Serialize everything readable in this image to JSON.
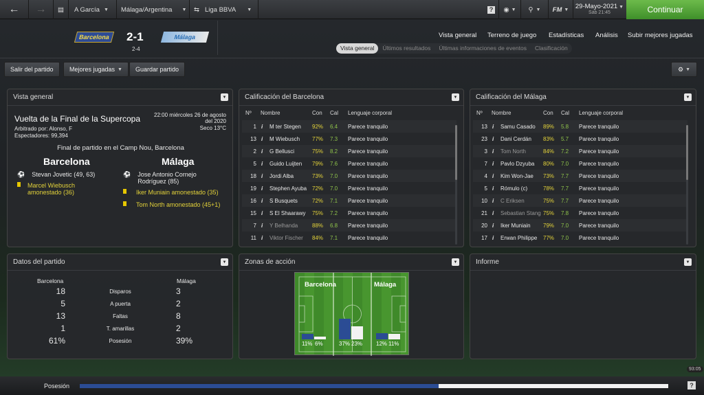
{
  "topbar": {
    "team": "A García",
    "nation": "Málaga/Argentina",
    "competition": "Liga BBVA",
    "date": "29-Mayo-2021",
    "subdate": "Sáb 21:45",
    "continue": "Continuar",
    "fm": "FM",
    "help": "?"
  },
  "match": {
    "home": "Barcelona",
    "away": "Málaga",
    "score": "2-1",
    "aggregate": "2-4"
  },
  "menu": [
    "Vista general",
    "Terreno de juego",
    "Estadísticas",
    "Análisis",
    "Subir mejores jugadas"
  ],
  "subtabs": [
    "Vista general",
    "Últimos resultados",
    "Últimas informaciones de eventos",
    "Clasificación"
  ],
  "actions": {
    "leave": "Salir del partido",
    "highlights": "Mejores jugadas",
    "save": "Guardar partido"
  },
  "overview": {
    "title": "Vista general",
    "competition": "Vuelta de la Final de la Supercopa",
    "datetime": "22:00 miércoles 26 de agosto del 2020",
    "referee": "Arbitrado por: Alonso, F",
    "spectators": "Espectadores: 99,394",
    "weather": "Seco 13°C",
    "final": "Final de partido en el Camp Nou, Barcelona",
    "home_events": [
      {
        "text": "Stevan Jovetic (49, 63)",
        "type": "goal"
      },
      {
        "text": "Marcel Wiebusch amonestado (36)",
        "type": "card"
      }
    ],
    "away_events": [
      {
        "text": "Jose Antonio Cornejo Rodríguez (85)",
        "type": "goal"
      },
      {
        "text": "Iker Muniain amonestado (35)",
        "type": "card"
      },
      {
        "text": "Tom North amonestado (45+1)",
        "type": "card"
      }
    ]
  },
  "ratings_home": {
    "title": "Calificación del Barcelona",
    "headers": [
      "Nº",
      "Nombre",
      "Con",
      "Cal",
      "Lenguaje corporal"
    ],
    "rows": [
      [
        "1",
        "M ter Stegen",
        "92%",
        "6.4",
        "Parece tranquilo"
      ],
      [
        "13",
        "M Wiebusch",
        "77%",
        "7.3",
        "Parece tranquilo"
      ],
      [
        "2",
        "G Bellusci",
        "75%",
        "8.2",
        "Parece tranquilo"
      ],
      [
        "5",
        "Guido Luijten",
        "79%",
        "7.6",
        "Parece tranquilo"
      ],
      [
        "18",
        "Jordi Alba",
        "73%",
        "7.0",
        "Parece tranquilo"
      ],
      [
        "19",
        "Stephen Ayuba",
        "72%",
        "7.0",
        "Parece tranquilo"
      ],
      [
        "16",
        "S Busquets",
        "72%",
        "7.1",
        "Parece tranquilo"
      ],
      [
        "15",
        "S El Shaarawy",
        "75%",
        "7.2",
        "Parece tranquilo"
      ],
      [
        "7",
        "Y Belhanda",
        "88%",
        "6.8",
        "Parece tranquilo"
      ],
      [
        "11",
        "Viktor Fischer",
        "84%",
        "7.1",
        "Parece tranquilo"
      ]
    ]
  },
  "ratings_away": {
    "title": "Calificación del Málaga",
    "headers": [
      "Nº",
      "Nombre",
      "Con",
      "Cal",
      "Lenguaje corporal"
    ],
    "rows": [
      [
        "13",
        "Samu Casado",
        "89%",
        "5.8",
        "Parece tranquilo"
      ],
      [
        "23",
        "Dani Cerdán",
        "83%",
        "5.7",
        "Parece tranquilo"
      ],
      [
        "3",
        "Tom North",
        "84%",
        "7.2",
        "Parece tranquilo"
      ],
      [
        "7",
        "Pavlo Dzyuba",
        "80%",
        "7.0",
        "Parece tranquilo"
      ],
      [
        "4",
        "Kim Won-Jae",
        "73%",
        "7.7",
        "Parece tranquilo"
      ],
      [
        "5",
        "Rómulo (c)",
        "78%",
        "7.7",
        "Parece tranquilo"
      ],
      [
        "10",
        "C Eriksen",
        "75%",
        "7.7",
        "Parece tranquilo"
      ],
      [
        "21",
        "Sebastian Stang",
        "75%",
        "7.8",
        "Parece tranquilo"
      ],
      [
        "20",
        "Iker Muniain",
        "79%",
        "7.0",
        "Parece tranquilo"
      ],
      [
        "17",
        "Erwan Philippe",
        "77%",
        "7.0",
        "Parece tranquilo"
      ]
    ]
  },
  "match_data": {
    "title": "Datos del partido",
    "home": "Barcelona",
    "away": "Málaga",
    "rows": [
      [
        "18",
        "Disparos",
        "3"
      ],
      [
        "5",
        "A puerta",
        "2"
      ],
      [
        "13",
        "Faltas",
        "8"
      ],
      [
        "1",
        "T. amarillas",
        "2"
      ],
      [
        "61%",
        "Posesión",
        "39%"
      ]
    ]
  },
  "zones": {
    "title": "Zonas de acción",
    "home": "Barcelona",
    "away": "Málaga",
    "values": [
      "11%",
      "6%",
      "37%",
      "23%",
      "12%",
      "11%"
    ]
  },
  "informe": {
    "title": "Informe"
  },
  "bottom": {
    "label": "Posesión",
    "clock": "93:05",
    "home_possession": 0.61,
    "help": "?"
  },
  "colors": {
    "accent": "#5cb53f",
    "home_bar": "#2b4c94",
    "yellow": "#e3d23a"
  }
}
